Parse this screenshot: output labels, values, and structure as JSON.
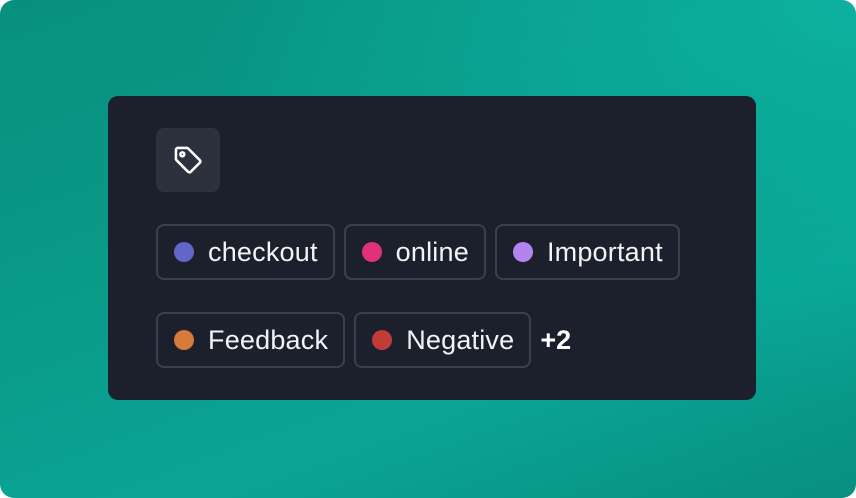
{
  "tags": {
    "row1": [
      {
        "label": "checkout",
        "color": "#6366c9"
      },
      {
        "label": "online",
        "color": "#e0317a"
      },
      {
        "label": "Important",
        "color": "#b384f0"
      }
    ],
    "row2": [
      {
        "label": "Feedback",
        "color": "#d87a3a"
      },
      {
        "label": "Negative",
        "color": "#c23b37"
      }
    ],
    "more": "+2"
  },
  "icons": {
    "header": "tag-icon"
  },
  "colors": {
    "background_teal": "#0a9c8a",
    "card": "#1c202c",
    "icon_box": "#2c313d",
    "chip_border": "#3b4050"
  }
}
